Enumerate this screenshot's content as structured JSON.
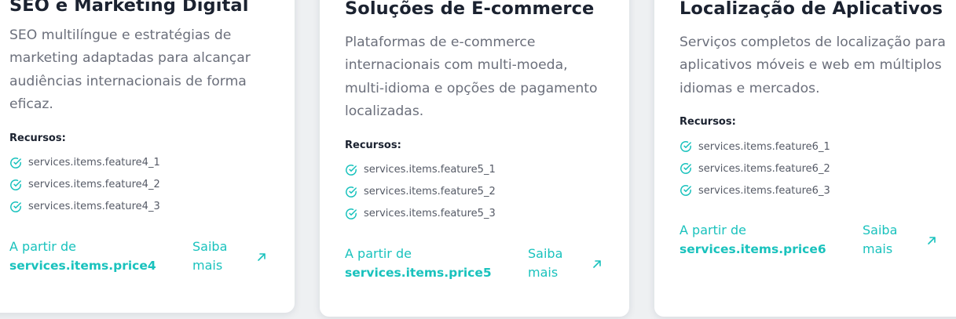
{
  "features_heading": "Recursos:",
  "price_prefix": "A partir de",
  "learn_more": "Saiba mais",
  "accent_color": "#19c2bd",
  "cards": [
    {
      "title": "SEO e Marketing Digital",
      "description": "SEO multilíngue e estratégias de marketing adaptadas para alcançar audiências internacionais de forma eficaz.",
      "features": [
        "services.items.feature4_1",
        "services.items.feature4_2",
        "services.items.feature4_3"
      ],
      "price": "services.items.price4"
    },
    {
      "title": "Soluções de E-commerce",
      "description": "Plataformas de e-commerce internacionais com multi-moeda, multi-idioma e opções de pagamento localizadas.",
      "features": [
        "services.items.feature5_1",
        "services.items.feature5_2",
        "services.items.feature5_3"
      ],
      "price": "services.items.price5"
    },
    {
      "title": "Localização de Aplicativos",
      "description": "Serviços completos de localização para aplicativos móveis e web em múltiplos idiomas e mercados.",
      "features": [
        "services.items.feature6_1",
        "services.items.feature6_2",
        "services.items.feature6_3"
      ],
      "price": "services.items.price6"
    }
  ]
}
